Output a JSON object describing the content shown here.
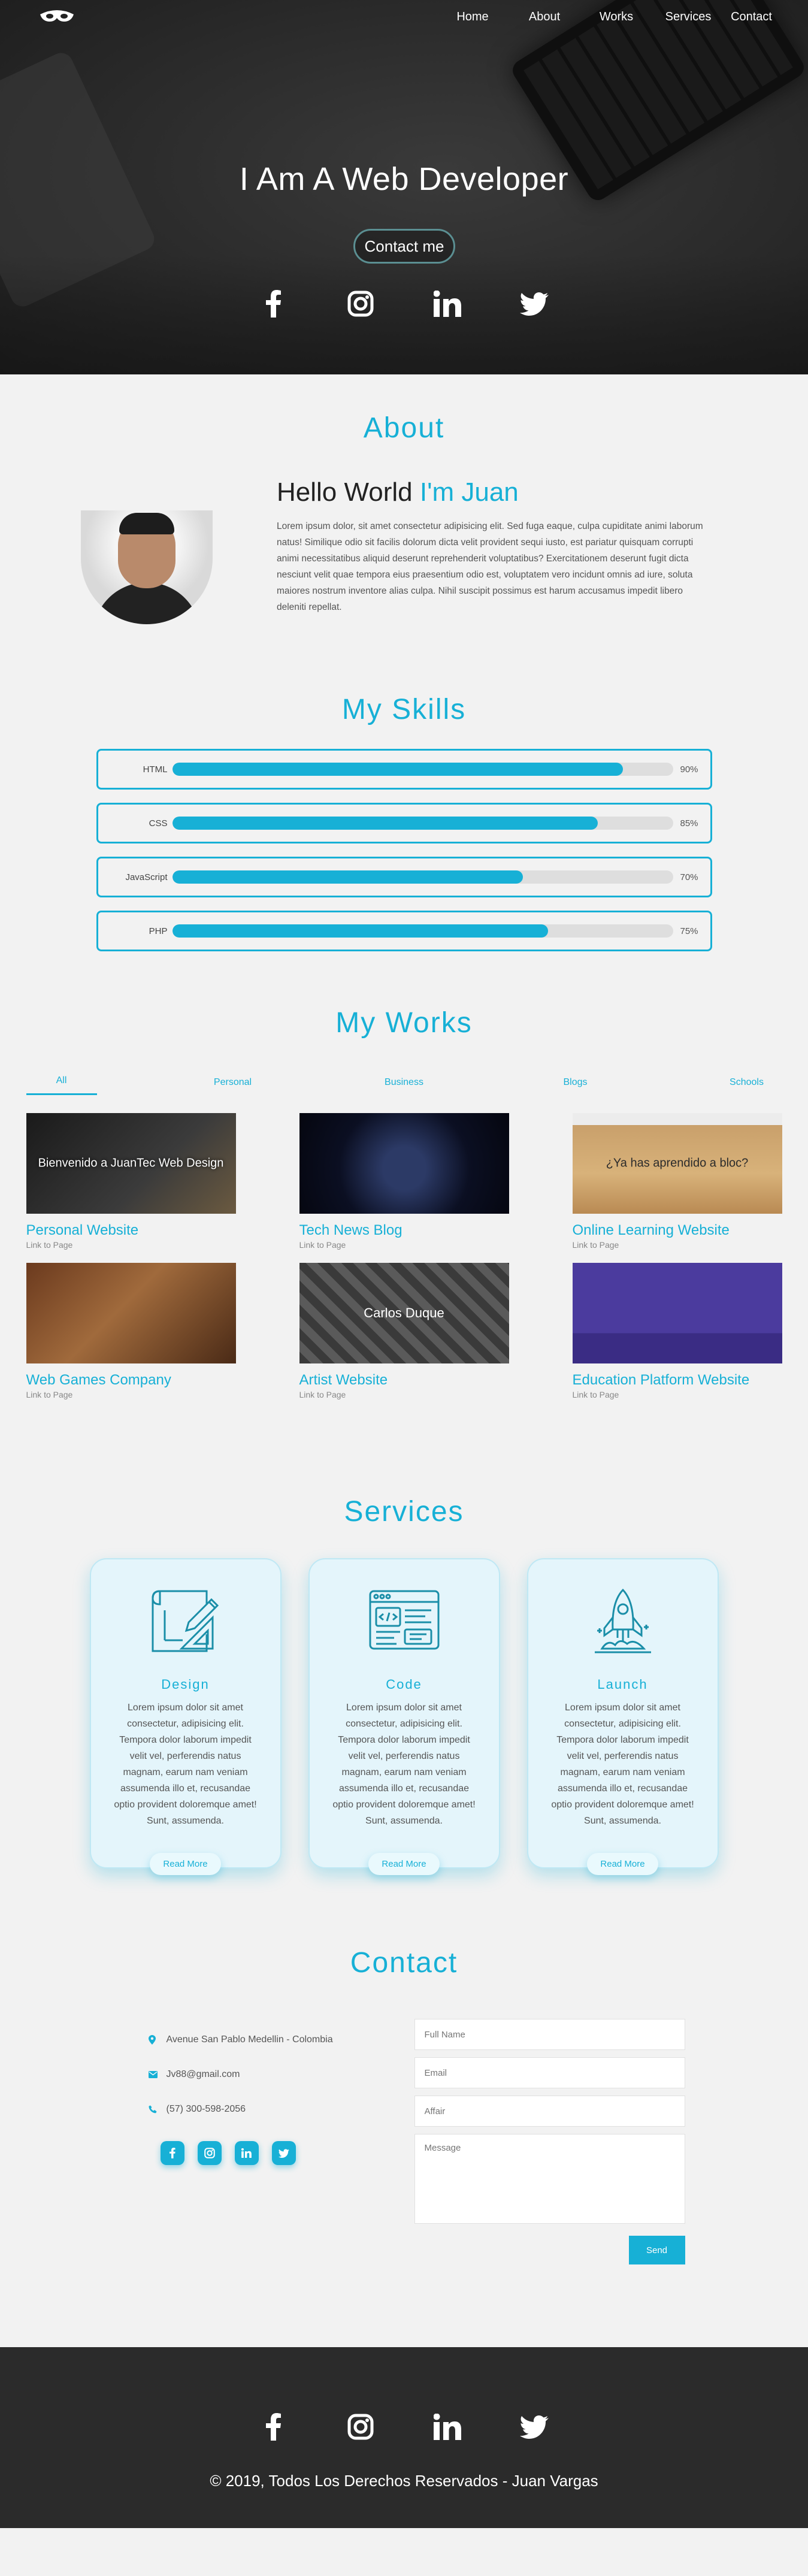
{
  "nav": {
    "links": [
      "Home",
      "About",
      "Works",
      "Services",
      "Contact"
    ]
  },
  "hero": {
    "title": "I Am A Web Developer",
    "button": "Contact me",
    "social_icons": [
      "facebook-icon",
      "instagram-icon",
      "linkedin-icon",
      "twitter-icon"
    ]
  },
  "about": {
    "title": "About",
    "hello": "Hello World",
    "name": "I'm Juan",
    "text": "Lorem ipsum dolor, sit amet consectetur adipisicing elit. Sed fuga eaque, culpa cupiditate animi laborum natus! Similique odio sit facilis dolorum dicta velit provident sequi iusto, est pariatur quisquam corrupti animi necessitatibus aliquid deserunt reprehenderit voluptatibus? Exercitationem deserunt fugit dicta nesciunt velit quae tempora eius praesentium odio est, voluptatem vero incidunt omnis ad iure, soluta maiores nostrum inventore alias culpa. Nihil suscipit possimus est harum accusamus impedit libero deleniti repellat."
  },
  "skills": {
    "title": "My Skills",
    "items": [
      {
        "label": "HTML",
        "value": 90,
        "pct": "90%"
      },
      {
        "label": "CSS",
        "value": 85,
        "pct": "85%"
      },
      {
        "label": "JavaScript",
        "value": 70,
        "pct": "70%"
      },
      {
        "label": "PHP",
        "value": 75,
        "pct": "75%"
      }
    ]
  },
  "works": {
    "title": "My Works",
    "tabs": [
      "All",
      "Personal",
      "Business",
      "Blogs",
      "Schools"
    ],
    "active_tab": "All",
    "items": [
      {
        "title": "Personal Website",
        "link": "Link to Page",
        "thumb_text": "Bienvenido a JuanTec Web Design"
      },
      {
        "title": "Tech News Blog",
        "link": "Link to Page",
        "thumb_text": ""
      },
      {
        "title": "Online Learning Website",
        "link": "Link to Page",
        "thumb_text": "¿Ya has aprendido a bloc?"
      },
      {
        "title": "Web Games Company",
        "link": "Link to Page",
        "thumb_text": ""
      },
      {
        "title": "Artist Website",
        "link": "Link to Page",
        "thumb_text": "Carlos Duque"
      },
      {
        "title": "Education Platform Website",
        "link": "Link to Page",
        "thumb_text": ""
      }
    ]
  },
  "services": {
    "title": "Services",
    "items": [
      {
        "title": "Design",
        "icon": "blueprint-icon",
        "text": "Lorem ipsum dolor sit amet consectetur, adipisicing elit. Tempora dolor laborum impedit velit vel, perferendis natus magnam, earum nam veniam assumenda illo et, recusandae optio provident doloremque amet! Sunt, assumenda.",
        "button": "Read More"
      },
      {
        "title": "Code",
        "icon": "code-window-icon",
        "text": "Lorem ipsum dolor sit amet consectetur, adipisicing elit. Tempora dolor laborum impedit velit vel, perferendis natus magnam, earum nam veniam assumenda illo et, recusandae optio provident doloremque amet! Sunt, assumenda.",
        "button": "Read More"
      },
      {
        "title": "Launch",
        "icon": "rocket-icon",
        "text": "Lorem ipsum dolor sit amet consectetur, adipisicing elit. Tempora dolor laborum impedit velit vel, perferendis natus magnam, earum nam veniam assumenda illo et, recusandae optio provident doloremque amet! Sunt, assumenda.",
        "button": "Read More"
      }
    ]
  },
  "contact": {
    "title": "Contact",
    "address": "Avenue San Pablo Medellin - Colombia",
    "email": "Jv88@gmail.com",
    "phone": "(57) 300-598-2056",
    "form": {
      "name_placeholder": "Full Name",
      "email_placeholder": "Email",
      "affair_placeholder": "Affair",
      "message_placeholder": "Message",
      "send": "Send"
    }
  },
  "footer": {
    "copyright": "© 2019, Todos Los Derechos Reservados - Juan Vargas"
  },
  "colors": {
    "accent": "#17b0d6",
    "dark": "#2b2b2b",
    "background": "#f2f2f2"
  }
}
